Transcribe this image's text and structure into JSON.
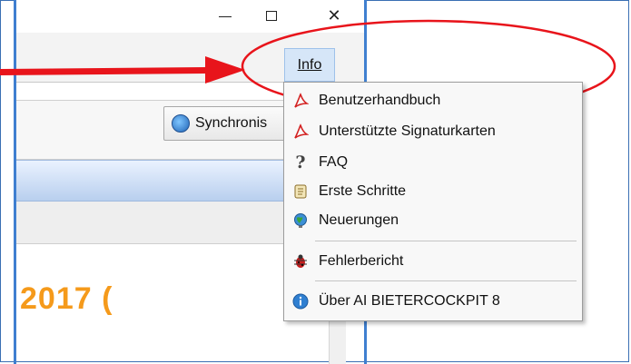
{
  "window": {
    "minimize_icon": "minimize-icon",
    "maximize_icon": "maximize-icon",
    "close_icon": "close-icon",
    "close_glyph": "✕"
  },
  "menubar": {
    "info_label": "Info"
  },
  "toolbar": {
    "sync_label": "Synchronis",
    "sync_icon": "sync-globe-icon"
  },
  "content": {
    "year_text": "2017 ("
  },
  "info_menu": {
    "items": [
      {
        "label": "Benutzerhandbuch",
        "icon": "pdf-icon"
      },
      {
        "label": "Unterstützte Signaturkarten",
        "icon": "pdf-icon"
      },
      {
        "label": "FAQ",
        "icon": "question-icon"
      },
      {
        "label": "Erste Schritte",
        "icon": "scroll-icon"
      },
      {
        "label": "Neuerungen",
        "icon": "globe-icon"
      },
      {
        "label": "Fehlerbericht",
        "icon": "bug-icon"
      },
      {
        "label": "Über AI BIETERCOCKPIT 8",
        "icon": "info-icon"
      }
    ]
  },
  "annotation": {
    "arrow_color": "#e8141b",
    "ellipse_color": "#e8141b"
  },
  "colors": {
    "accent_orange": "#f59a1b",
    "window_border": "#3f7fd0",
    "menu_highlight": "#d6e6f8"
  }
}
